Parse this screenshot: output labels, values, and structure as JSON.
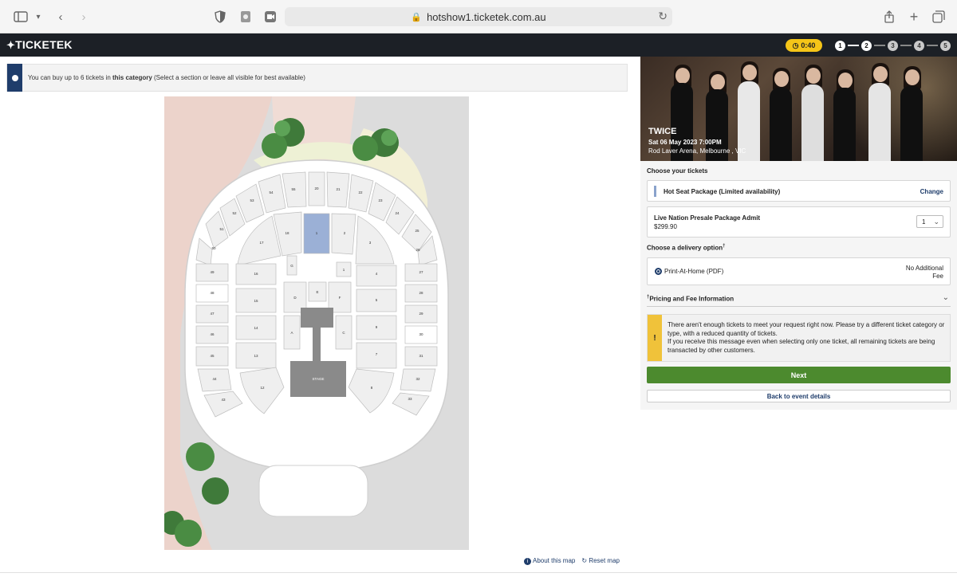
{
  "browser": {
    "url": "hotshow1.ticketek.com.au"
  },
  "header": {
    "logo": "TICKETEK",
    "timer": "0:40",
    "steps": [
      "1",
      "2",
      "3",
      "4",
      "5"
    ]
  },
  "info": {
    "text_prefix": "You can buy up to 6 tickets in ",
    "text_bold": "this category",
    "text_suffix": " (Select a section or leave all visible for best available)"
  },
  "map": {
    "about_label": "About this map",
    "reset_label": "Reset map",
    "stage_label": "STAGE",
    "sections_outer_left": [
      "33",
      "32",
      "51",
      "50",
      "49",
      "48",
      "47",
      "46",
      "45",
      "44",
      "43"
    ],
    "sections_top": [
      "54",
      "55",
      "20",
      "21",
      "22",
      "23",
      "24",
      "25",
      "26"
    ],
    "sections_right": [
      "27",
      "28",
      "29",
      "30",
      "31",
      "32",
      "33"
    ],
    "sections_inner": [
      "18",
      "1",
      "2",
      "17",
      "3",
      "16",
      "4",
      "15",
      "5",
      "14",
      "9",
      "13",
      "7",
      "12",
      "8"
    ],
    "floor": [
      "G",
      "D",
      "E",
      "F",
      "A",
      "B",
      "C",
      "I"
    ],
    "selected_section": "1"
  },
  "event": {
    "name": "TWICE",
    "date": "Sat 06 May 2023 7:00PM",
    "venue": "Rod Laver Arena, Melbourne , VIC"
  },
  "tickets": {
    "section_label": "Choose your tickets",
    "package_name": "Hot Seat Package (Limited availability)",
    "change_label": "Change",
    "presale_name": "Live Nation Presale Package Admit",
    "presale_price": "$299.90",
    "quantity": "1"
  },
  "delivery": {
    "section_label": "Choose a delivery option",
    "dagger": "†",
    "option": "Print-At-Home (PDF)",
    "fee_line1": "No Additional",
    "fee_line2": "Fee"
  },
  "pricing": {
    "dagger": "†",
    "label": "Pricing and Fee Information"
  },
  "warning": {
    "icon": "!",
    "line1": "There aren't enough tickets to meet your request right now. Please try a different ticket category or type, with a reduced quantity of tickets.",
    "line2": "If you receive this message even when selecting only one ticket, all remaining tickets are being transacted by other customers."
  },
  "actions": {
    "next": "Next",
    "back": "Back to event details"
  },
  "colors": {
    "brand_dark": "#1c2026",
    "accent_blue": "#1f3d6b",
    "next_green": "#4c8a2e",
    "warn_yellow": "#f0c23a",
    "timer_yellow": "#f5c518",
    "selected_section": "#9bb0d6"
  }
}
